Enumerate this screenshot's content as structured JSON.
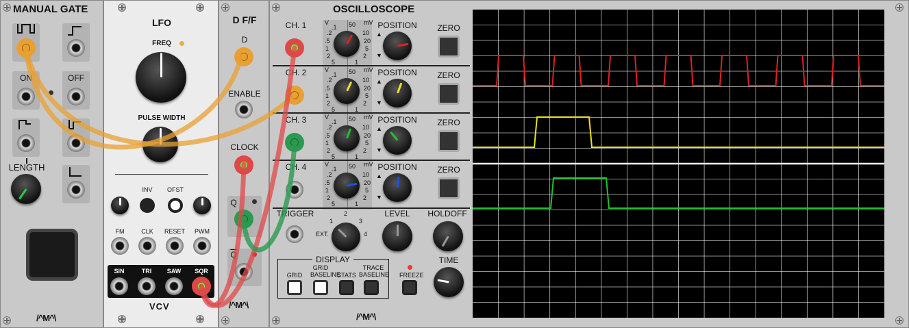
{
  "manual_gate": {
    "title": "MANUAL GATE",
    "on_label": "ON",
    "off_label": "OFF",
    "length_label": "LENGTH",
    "logo": "/^M^\\"
  },
  "lfo": {
    "title": "LFO",
    "freq_label": "FREQ",
    "pulse_width_label": "PULSE WIDTH",
    "inv_label": "INV",
    "ofst_label": "OFST",
    "fm_label": "FM",
    "clk_label": "CLK",
    "reset_label": "RESET",
    "pwm_label": "PWM",
    "sin_label": "SIN",
    "tri_label": "TRI",
    "saw_label": "SAW",
    "sqr_label": "SQR",
    "logo": "VCV"
  },
  "dff": {
    "title": "D F/F",
    "d_label": "D",
    "enable_label": "ENABLE",
    "clock_label": "CLOCK",
    "q_label": "Q",
    "qbar_label": "Q",
    "logo": "/^M^\\"
  },
  "scope": {
    "title": "OSCILLOSCOPE",
    "channels": [
      {
        "label": "CH. 1",
        "position_label": "POSITION",
        "zero_label": "ZERO",
        "color": "#e02020"
      },
      {
        "label": "CH. 2",
        "position_label": "POSITION",
        "zero_label": "ZERO",
        "color": "#f0e020"
      },
      {
        "label": "CH. 3",
        "position_label": "POSITION",
        "zero_label": "ZERO",
        "color": "#20c030"
      },
      {
        "label": "CH. 4",
        "position_label": "POSITION",
        "zero_label": "ZERO",
        "color": "#2050e0"
      }
    ],
    "gauge": {
      "v": "V",
      "mv": "mV",
      "v1": ".1",
      "v2": ".2",
      "v5": ".5",
      "n1": "1",
      "n2": "2",
      "n5": "5",
      "n50": "50",
      "n10": "10",
      "n20": "20"
    },
    "trigger_label": "TRIGGER",
    "ext_label": "EXT.",
    "trig_nums": [
      "1",
      "2",
      "3",
      "4"
    ],
    "level_label": "LEVEL",
    "holdoff_label": "HOLDOFF",
    "time_label": "TIME",
    "display_label": "DISPLAY",
    "grid_label": "GRID",
    "grid_baseline_label": "GRID BASELINE",
    "stats_label": "STATS",
    "trace_baseline_label": "TRACE BASELINE",
    "freeze_label": "FREEZE",
    "logo": "/^M^\\"
  },
  "colors": {
    "cable_orange": "#e8a030",
    "cable_red": "#e04848",
    "cable_green": "#2a9a50",
    "trace_red": "#e02020",
    "trace_yellow": "#f0e020",
    "trace_green": "#20c030"
  }
}
